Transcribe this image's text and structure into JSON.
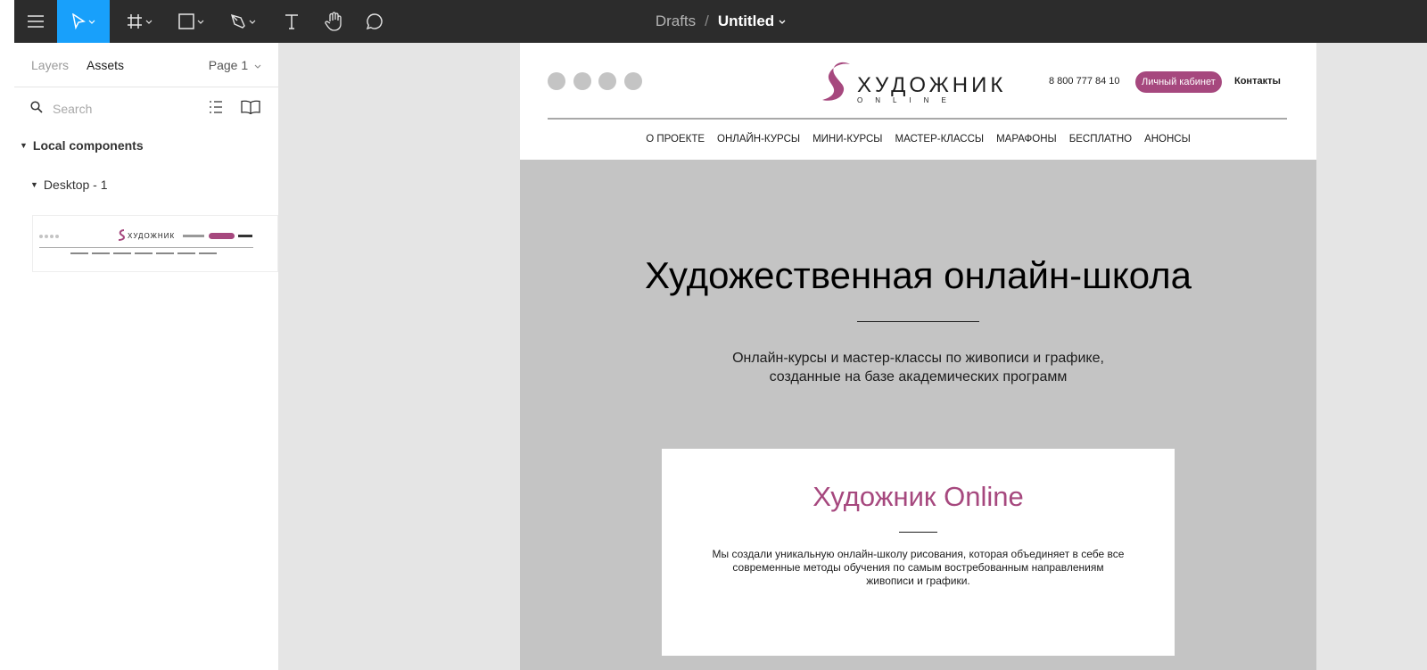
{
  "toolbar": {
    "breadcrumb": "Drafts",
    "separator": "/",
    "file_name": "Untitled",
    "accent": "#18a0fb",
    "icons": [
      "menu-icon",
      "move-icon",
      "frame-icon",
      "rectangle-icon",
      "pen-icon",
      "text-icon",
      "hand-icon",
      "comment-icon"
    ]
  },
  "panel": {
    "tabs": [
      "Layers",
      "Assets"
    ],
    "active_tab": "Assets",
    "page": "Page 1",
    "search_placeholder": "Search",
    "section": "Local components",
    "component": "Desktop - 1"
  },
  "site": {
    "logo_word": "ХУДОЖНИК",
    "logo_sub": "ONLINE",
    "phone": "8 800 777 84 10",
    "cabinet": "Личный кабинет",
    "contacts": "Контакты",
    "brand_color": "#a6487e",
    "nav": [
      "О ПРОЕКТЕ",
      "ОНЛАЙН-КУРСЫ",
      "МИНИ-КУРСЫ",
      "МАСТЕР-КЛАССЫ",
      "МАРАФОНЫ",
      "БЕСПЛАТНО",
      "АНОНСЫ"
    ],
    "hero_title": "Художественная онлайн-школа",
    "hero_sub_1": "Онлайн-курсы и мастер-классы по живописи и графике,",
    "hero_sub_2": "созданные на базе академических программ",
    "card_title": "Художник Online",
    "card_text_1": "Мы создали уникальную онлайн-школу рисования, которая объединяет в себе все",
    "card_text_2": "современные методы обучения по самым востребованным направлениям",
    "card_text_3": "живописи и графики."
  }
}
